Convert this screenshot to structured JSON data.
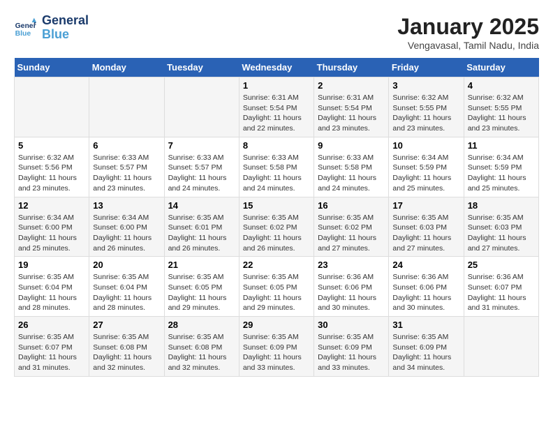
{
  "header": {
    "logo_line1": "General",
    "logo_line2": "Blue",
    "title": "January 2025",
    "subtitle": "Vengavasal, Tamil Nadu, India"
  },
  "calendar": {
    "days_of_week": [
      "Sunday",
      "Monday",
      "Tuesday",
      "Wednesday",
      "Thursday",
      "Friday",
      "Saturday"
    ],
    "weeks": [
      [
        {
          "day": "",
          "content": ""
        },
        {
          "day": "",
          "content": ""
        },
        {
          "day": "",
          "content": ""
        },
        {
          "day": "1",
          "content": "Sunrise: 6:31 AM\nSunset: 5:54 PM\nDaylight: 11 hours and 22 minutes."
        },
        {
          "day": "2",
          "content": "Sunrise: 6:31 AM\nSunset: 5:54 PM\nDaylight: 11 hours and 23 minutes."
        },
        {
          "day": "3",
          "content": "Sunrise: 6:32 AM\nSunset: 5:55 PM\nDaylight: 11 hours and 23 minutes."
        },
        {
          "day": "4",
          "content": "Sunrise: 6:32 AM\nSunset: 5:55 PM\nDaylight: 11 hours and 23 minutes."
        }
      ],
      [
        {
          "day": "5",
          "content": "Sunrise: 6:32 AM\nSunset: 5:56 PM\nDaylight: 11 hours and 23 minutes."
        },
        {
          "day": "6",
          "content": "Sunrise: 6:33 AM\nSunset: 5:57 PM\nDaylight: 11 hours and 23 minutes."
        },
        {
          "day": "7",
          "content": "Sunrise: 6:33 AM\nSunset: 5:57 PM\nDaylight: 11 hours and 24 minutes."
        },
        {
          "day": "8",
          "content": "Sunrise: 6:33 AM\nSunset: 5:58 PM\nDaylight: 11 hours and 24 minutes."
        },
        {
          "day": "9",
          "content": "Sunrise: 6:33 AM\nSunset: 5:58 PM\nDaylight: 11 hours and 24 minutes."
        },
        {
          "day": "10",
          "content": "Sunrise: 6:34 AM\nSunset: 5:59 PM\nDaylight: 11 hours and 25 minutes."
        },
        {
          "day": "11",
          "content": "Sunrise: 6:34 AM\nSunset: 5:59 PM\nDaylight: 11 hours and 25 minutes."
        }
      ],
      [
        {
          "day": "12",
          "content": "Sunrise: 6:34 AM\nSunset: 6:00 PM\nDaylight: 11 hours and 25 minutes."
        },
        {
          "day": "13",
          "content": "Sunrise: 6:34 AM\nSunset: 6:00 PM\nDaylight: 11 hours and 26 minutes."
        },
        {
          "day": "14",
          "content": "Sunrise: 6:35 AM\nSunset: 6:01 PM\nDaylight: 11 hours and 26 minutes."
        },
        {
          "day": "15",
          "content": "Sunrise: 6:35 AM\nSunset: 6:02 PM\nDaylight: 11 hours and 26 minutes."
        },
        {
          "day": "16",
          "content": "Sunrise: 6:35 AM\nSunset: 6:02 PM\nDaylight: 11 hours and 27 minutes."
        },
        {
          "day": "17",
          "content": "Sunrise: 6:35 AM\nSunset: 6:03 PM\nDaylight: 11 hours and 27 minutes."
        },
        {
          "day": "18",
          "content": "Sunrise: 6:35 AM\nSunset: 6:03 PM\nDaylight: 11 hours and 27 minutes."
        }
      ],
      [
        {
          "day": "19",
          "content": "Sunrise: 6:35 AM\nSunset: 6:04 PM\nDaylight: 11 hours and 28 minutes."
        },
        {
          "day": "20",
          "content": "Sunrise: 6:35 AM\nSunset: 6:04 PM\nDaylight: 11 hours and 28 minutes."
        },
        {
          "day": "21",
          "content": "Sunrise: 6:35 AM\nSunset: 6:05 PM\nDaylight: 11 hours and 29 minutes."
        },
        {
          "day": "22",
          "content": "Sunrise: 6:35 AM\nSunset: 6:05 PM\nDaylight: 11 hours and 29 minutes."
        },
        {
          "day": "23",
          "content": "Sunrise: 6:36 AM\nSunset: 6:06 PM\nDaylight: 11 hours and 30 minutes."
        },
        {
          "day": "24",
          "content": "Sunrise: 6:36 AM\nSunset: 6:06 PM\nDaylight: 11 hours and 30 minutes."
        },
        {
          "day": "25",
          "content": "Sunrise: 6:36 AM\nSunset: 6:07 PM\nDaylight: 11 hours and 31 minutes."
        }
      ],
      [
        {
          "day": "26",
          "content": "Sunrise: 6:35 AM\nSunset: 6:07 PM\nDaylight: 11 hours and 31 minutes."
        },
        {
          "day": "27",
          "content": "Sunrise: 6:35 AM\nSunset: 6:08 PM\nDaylight: 11 hours and 32 minutes."
        },
        {
          "day": "28",
          "content": "Sunrise: 6:35 AM\nSunset: 6:08 PM\nDaylight: 11 hours and 32 minutes."
        },
        {
          "day": "29",
          "content": "Sunrise: 6:35 AM\nSunset: 6:09 PM\nDaylight: 11 hours and 33 minutes."
        },
        {
          "day": "30",
          "content": "Sunrise: 6:35 AM\nSunset: 6:09 PM\nDaylight: 11 hours and 33 minutes."
        },
        {
          "day": "31",
          "content": "Sunrise: 6:35 AM\nSunset: 6:09 PM\nDaylight: 11 hours and 34 minutes."
        },
        {
          "day": "",
          "content": ""
        }
      ]
    ]
  }
}
